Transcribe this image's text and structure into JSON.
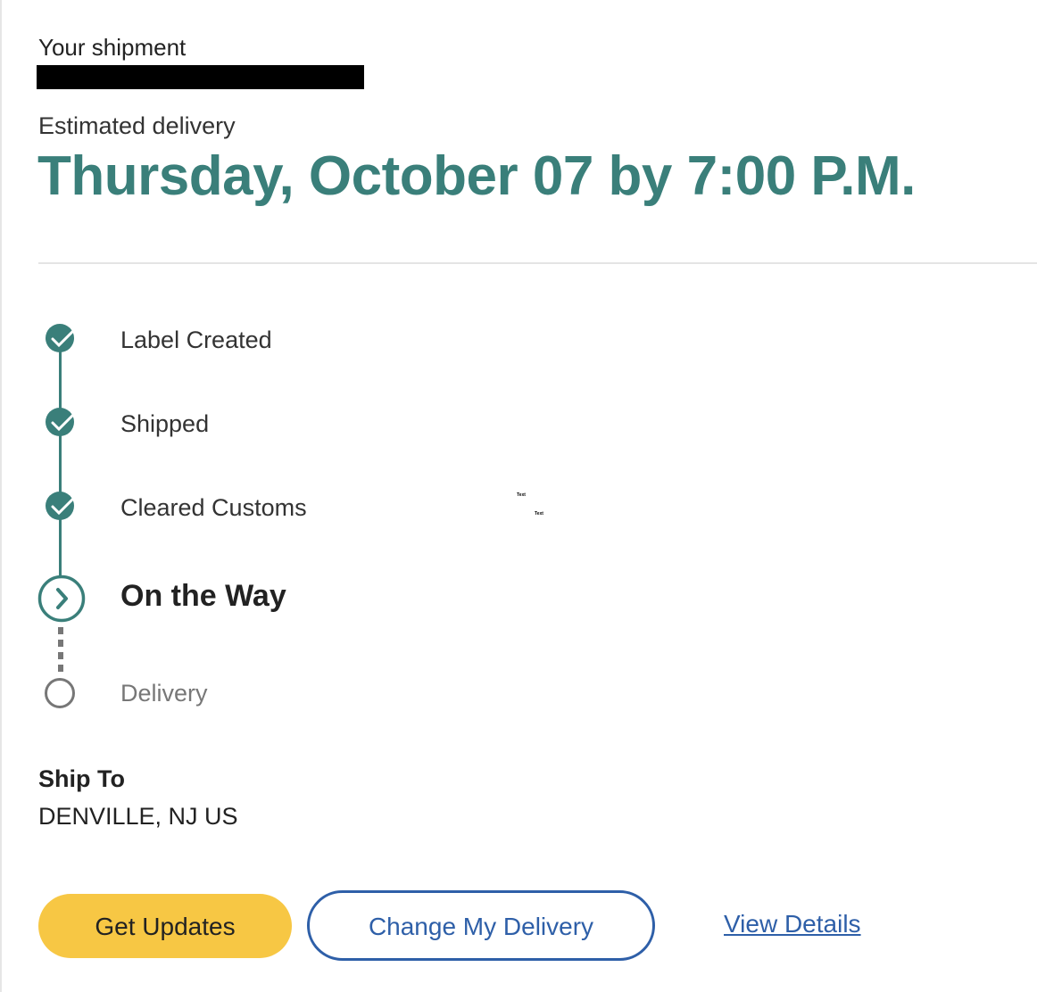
{
  "shipment": {
    "label": "Your shipment"
  },
  "estimate": {
    "label": "Estimated delivery",
    "date": "Thursday, October 07 by 7:00 P.M."
  },
  "milestones": [
    {
      "label": "Label Created",
      "status": "complete"
    },
    {
      "label": "Shipped",
      "status": "complete"
    },
    {
      "label": "Cleared Customs",
      "status": "complete"
    },
    {
      "label": "On the Way",
      "status": "current"
    },
    {
      "label": "Delivery",
      "status": "pending"
    }
  ],
  "stray_text": [
    "Text",
    "Text"
  ],
  "ship_to": {
    "heading": "Ship To",
    "value": "DENVILLE, NJ US"
  },
  "actions": {
    "get_updates": "Get Updates",
    "change_delivery": "Change My Delivery",
    "view_details": "View Details"
  },
  "colors": {
    "accent": "#3a7f7a",
    "button_yellow": "#f7c744",
    "link_blue": "#2e5fa8",
    "pending_gray": "#777777"
  },
  "icons": {
    "complete": "check-circle-icon",
    "current": "chevron-right-circle-icon",
    "pending": "empty-circle-icon"
  }
}
